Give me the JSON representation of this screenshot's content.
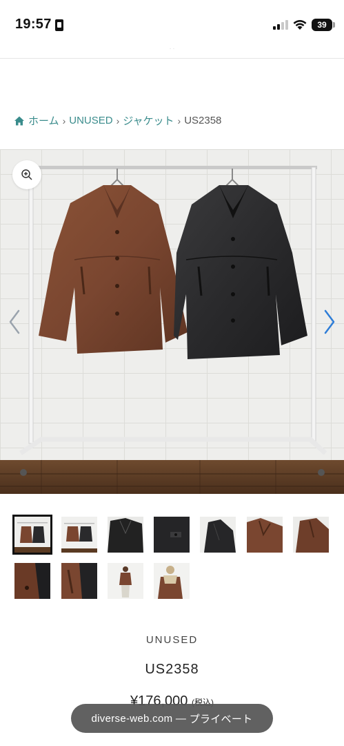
{
  "status_bar": {
    "time": "19:57",
    "battery": "39"
  },
  "browser": {
    "url_hint": "· ·",
    "toast_domain": "diverse-web.com",
    "toast_separator": " — ",
    "toast_mode": "プライベート"
  },
  "breadcrumb": {
    "items": [
      "ホーム",
      "UNUSED",
      "ジャケット"
    ],
    "current": "US2358",
    "separator": "›"
  },
  "gallery": {
    "thumbnails_count": 11,
    "selected_index": 0
  },
  "product": {
    "brand": "UNUSED",
    "code": "US2358",
    "price": "¥176,000",
    "tax_note": "(税込)"
  },
  "colors": {
    "accent": "#3a8c8c",
    "arrow_active": "#2e7dd7",
    "arrow_inactive": "#9aa3ad",
    "brown_leather": "#7a4630",
    "black_leather": "#2a2a2c"
  },
  "icons": {
    "home": "home-icon",
    "zoom": "zoom-in-icon",
    "prev": "chevron-left-icon",
    "next": "chevron-right-icon"
  }
}
